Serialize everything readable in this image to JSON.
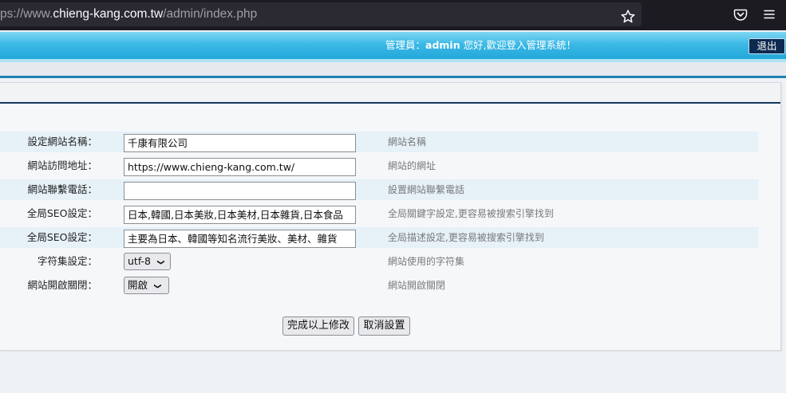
{
  "browser": {
    "url_prefix": "ps://www.",
    "url_domain": "chieng-kang.com.tw",
    "url_path": "/admin/index.php",
    "icons": [
      "star-icon",
      "pocket-icon",
      "menu-icon"
    ]
  },
  "header": {
    "welcome_prefix": "管理員：",
    "admin_name": "admin",
    "welcome_suffix": " 您好,歡迎登入管理系統！",
    "logout_label": "退出"
  },
  "form": {
    "rows": [
      {
        "label": "設定網站名稱：",
        "type": "input",
        "value": "千康有限公司",
        "help": "網站名稱"
      },
      {
        "label": "網站訪問地址：",
        "type": "input",
        "value": "https://www.chieng-kang.com.tw/",
        "help": "網站的網址"
      },
      {
        "label": "網站聯繫電話：",
        "type": "input",
        "value": "",
        "help": "設置網站聯繫電話"
      },
      {
        "label": "全局SEO設定：",
        "type": "input",
        "value": "日本,韓國,日本美妝,日本美材,日本雜貨,日本食品",
        "help": "全局關鍵字設定,更容易被搜索引擎找到"
      },
      {
        "label": "全局SEO設定：",
        "type": "input",
        "value": "主要為日本、韓國等知名流行美妝、美材、雜貨",
        "help": "全局描述設定,更容易被搜索引擎找到"
      },
      {
        "label": "字符集設定：",
        "type": "select",
        "value": "utf-8",
        "help": "網站使用的字符集"
      },
      {
        "label": "網站開啟關閉：",
        "type": "select",
        "value": "開啟",
        "help": "網站開啟關閉"
      }
    ],
    "submit_label": "完成以上修改",
    "cancel_label": "取消設置"
  },
  "colors": {
    "header_blue": "#22a7da",
    "rule_blue": "#1f7fb3",
    "title_rule": "#13385f",
    "logout_bg": "#0d2a50",
    "alt_row": "#e6f1f8"
  }
}
